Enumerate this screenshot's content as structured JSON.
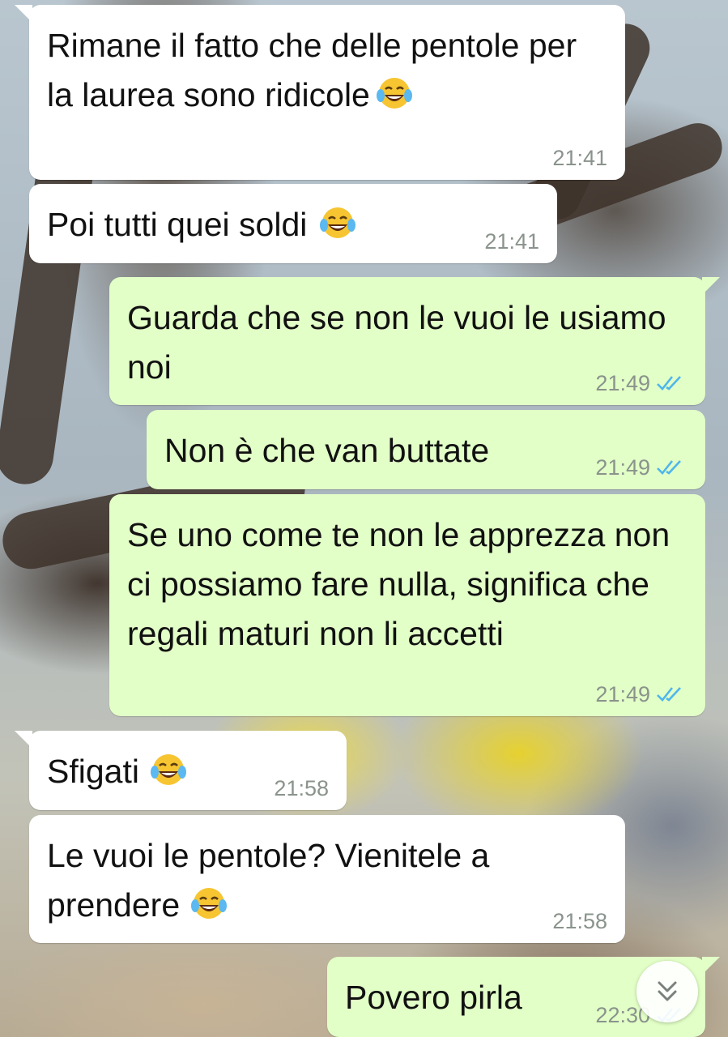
{
  "colors": {
    "incoming_bubble": "#ffffff",
    "outgoing_bubble": "#e2ffc7",
    "timestamp": "#8a938c",
    "read_ticks": "#4fb6ec"
  },
  "messages": [
    {
      "direction": "incoming",
      "text": "Rimane il fatto che delle pentole per la laurea sono ridicole",
      "emoji": "face-with-tears-of-joy",
      "time": "21:41"
    },
    {
      "direction": "incoming",
      "text": "Poi tutti quei soldi",
      "emoji": "face-with-tears-of-joy",
      "time": "21:41"
    },
    {
      "direction": "outgoing",
      "text": "Guarda che se non le vuoi le usiamo noi",
      "time": "21:49",
      "status": "read"
    },
    {
      "direction": "outgoing",
      "text": "Non è che van buttate",
      "time": "21:49",
      "status": "read"
    },
    {
      "direction": "outgoing",
      "text": "Se uno come te non le apprezza non ci possiamo fare nulla, significa che regali maturi non li accetti",
      "time": "21:49",
      "status": "read"
    },
    {
      "direction": "incoming",
      "text": "Sfigati",
      "emoji": "face-with-tears-of-joy",
      "time": "21:58"
    },
    {
      "direction": "incoming",
      "text": "Le vuoi le pentole? Vienitele a prendere",
      "emoji": "face-with-tears-of-joy",
      "time": "21:58"
    },
    {
      "direction": "outgoing",
      "text": "Povero pirla",
      "time": "22:30",
      "status": "read"
    }
  ],
  "scroll_button": {
    "icon": "double-chevron-down-icon"
  }
}
